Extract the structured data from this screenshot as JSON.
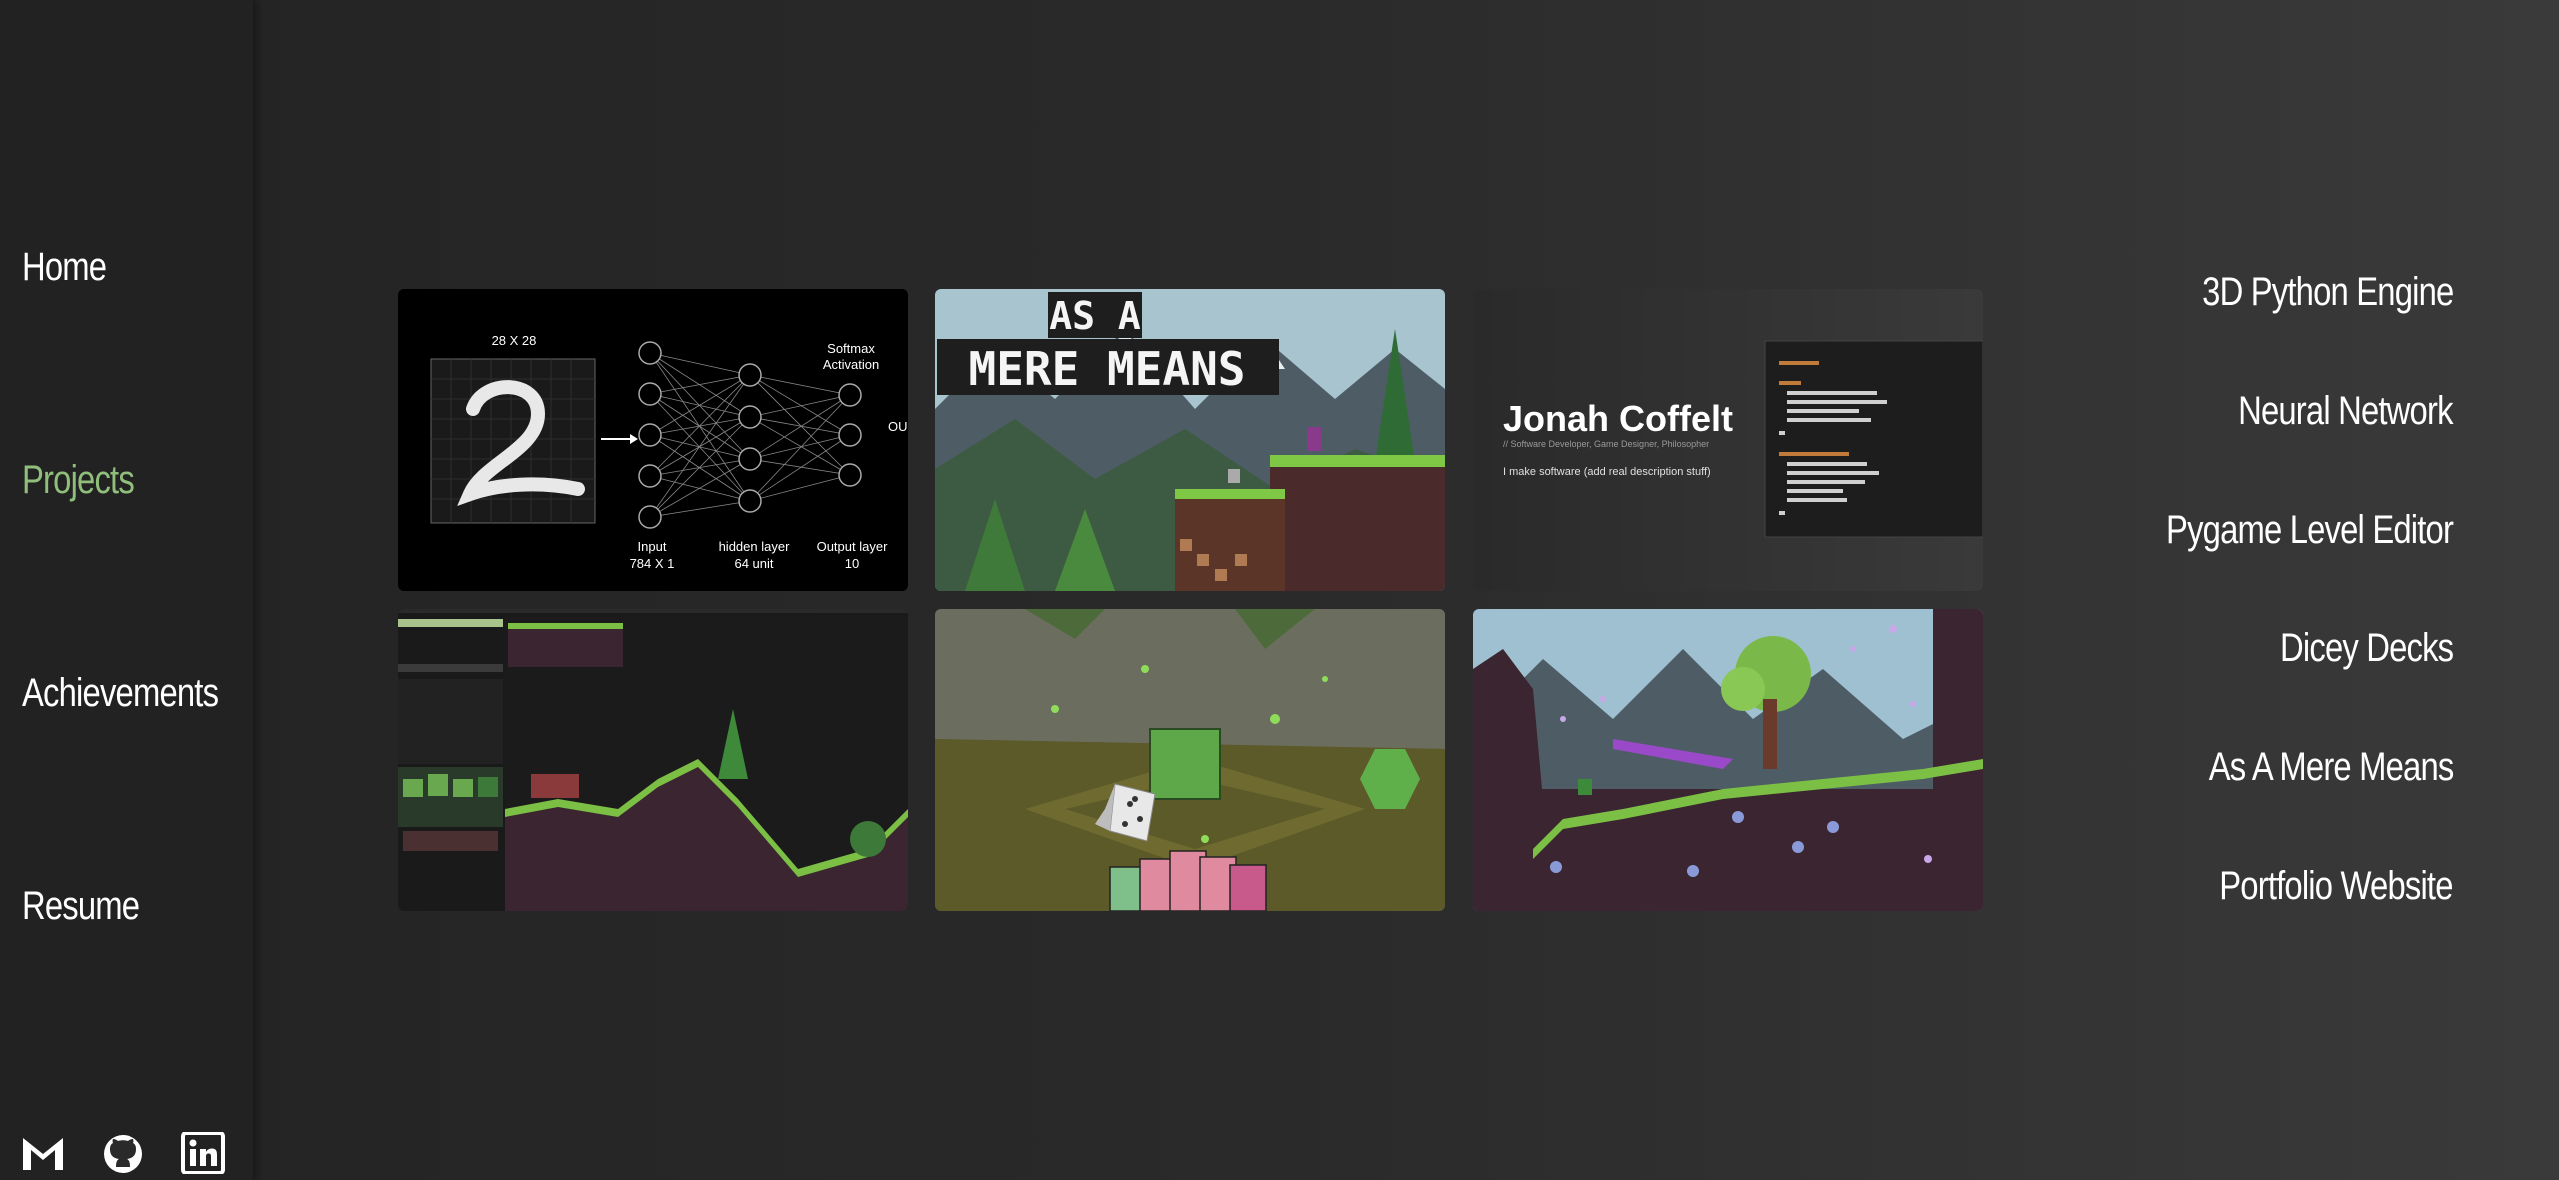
{
  "nav": {
    "home": "Home",
    "projects": "Projects",
    "achievements": "Achievements",
    "resume": "Resume"
  },
  "colors": {
    "active": "#8fbf7a",
    "background": "#2a2a2a",
    "sidebar": "#222222"
  },
  "social": [
    "gmail-icon",
    "github-icon",
    "linkedin-icon"
  ],
  "cards": {
    "neural": {
      "size_label": "28 X 28",
      "softmax_line1": "Softmax",
      "softmax_line2": "Activation",
      "out_partial": "OU",
      "input_line1": "Input",
      "input_line2": "784 X 1",
      "hidden_line1": "hidden layer",
      "hidden_line2": "64 unit",
      "output_line1": "Output layer",
      "output_line2": "10"
    },
    "mere_means": {
      "title_line1": "AS A",
      "title_line2": "MERE MEANS"
    },
    "portfolio": {
      "name": "Jonah Coffelt",
      "tagline": "// Software Developer, Game Designer, Philosopher",
      "description": "I make software (add real description stuff)"
    }
  },
  "projects": [
    "3D Python Engine",
    "Neural Network",
    "Pygame Level Editor",
    "Dicey Decks",
    "As A Mere Means",
    "Portfolio Website"
  ]
}
